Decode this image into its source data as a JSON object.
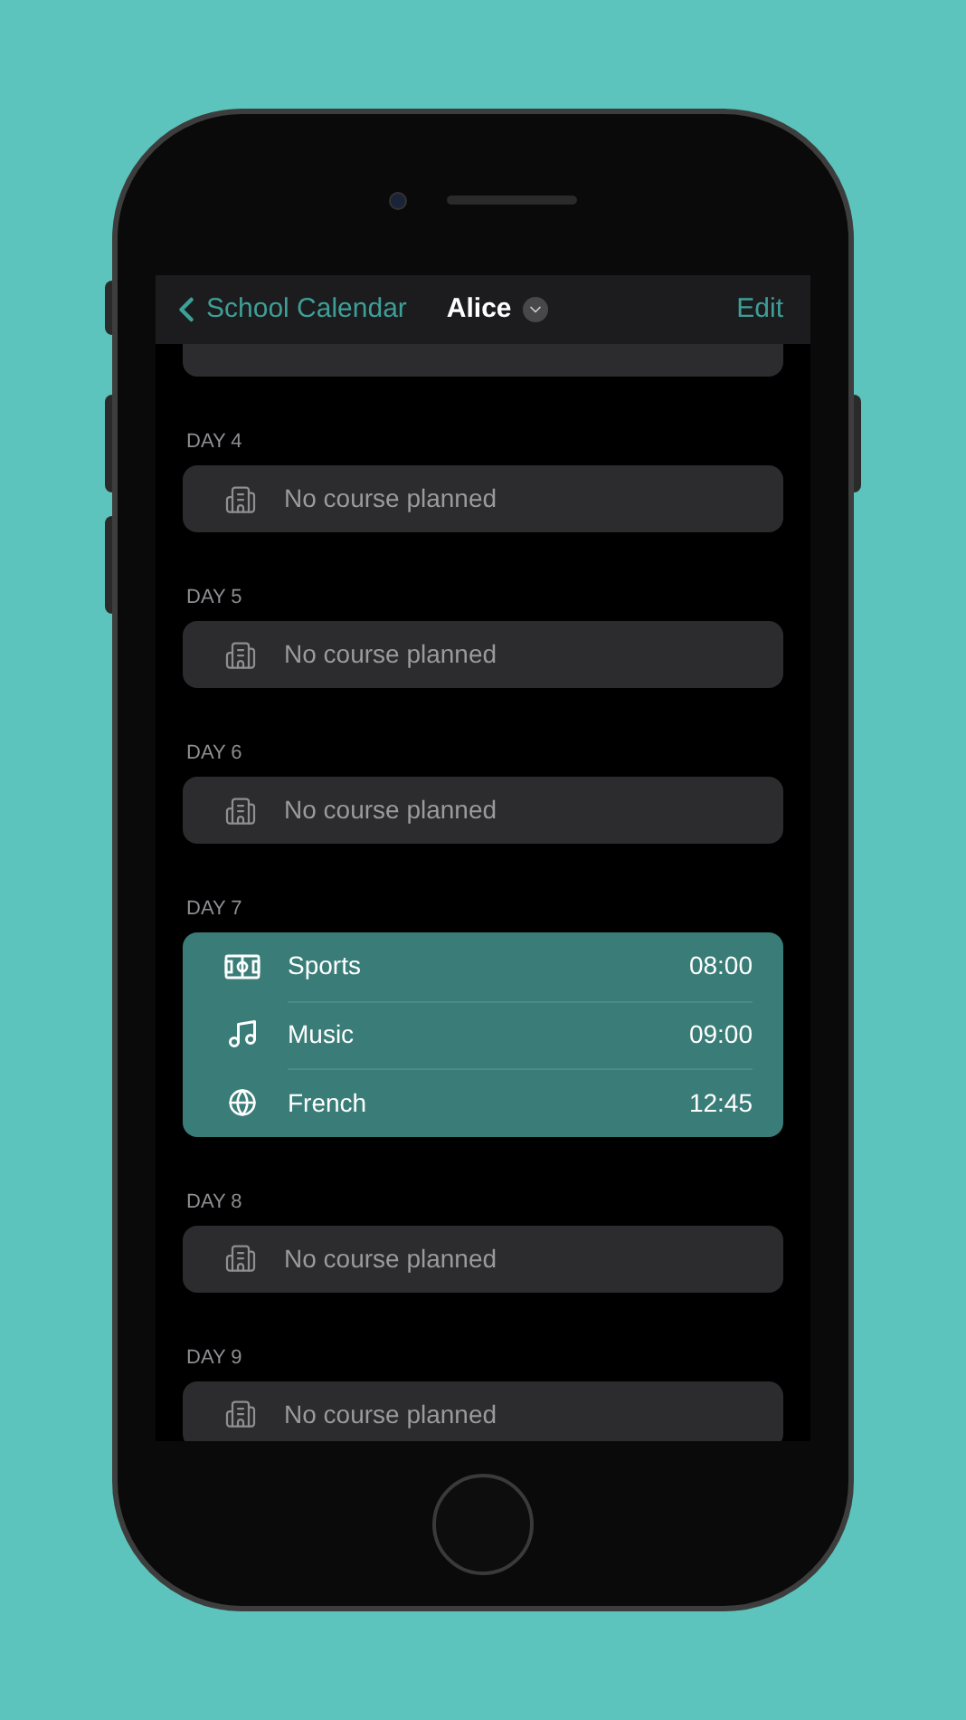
{
  "nav_bar": {
    "back_label": "School Calendar",
    "title": "Alice",
    "action": "Edit"
  },
  "days": [
    {
      "label": "DAY 4",
      "empty_text": "No course planned"
    },
    {
      "label": "DAY 5",
      "empty_text": "No course planned"
    },
    {
      "label": "DAY 6",
      "empty_text": "No course planned"
    },
    {
      "label": "DAY 7",
      "courses": [
        {
          "kind": "sports",
          "name": "Sports",
          "time": "08:00"
        },
        {
          "kind": "music",
          "name": "Music",
          "time": "09:00"
        },
        {
          "kind": "language",
          "name": "French",
          "time": "12:45"
        }
      ]
    },
    {
      "label": "DAY 8",
      "empty_text": "No course planned"
    },
    {
      "label": "DAY 9",
      "empty_text": "No course planned"
    }
  ]
}
